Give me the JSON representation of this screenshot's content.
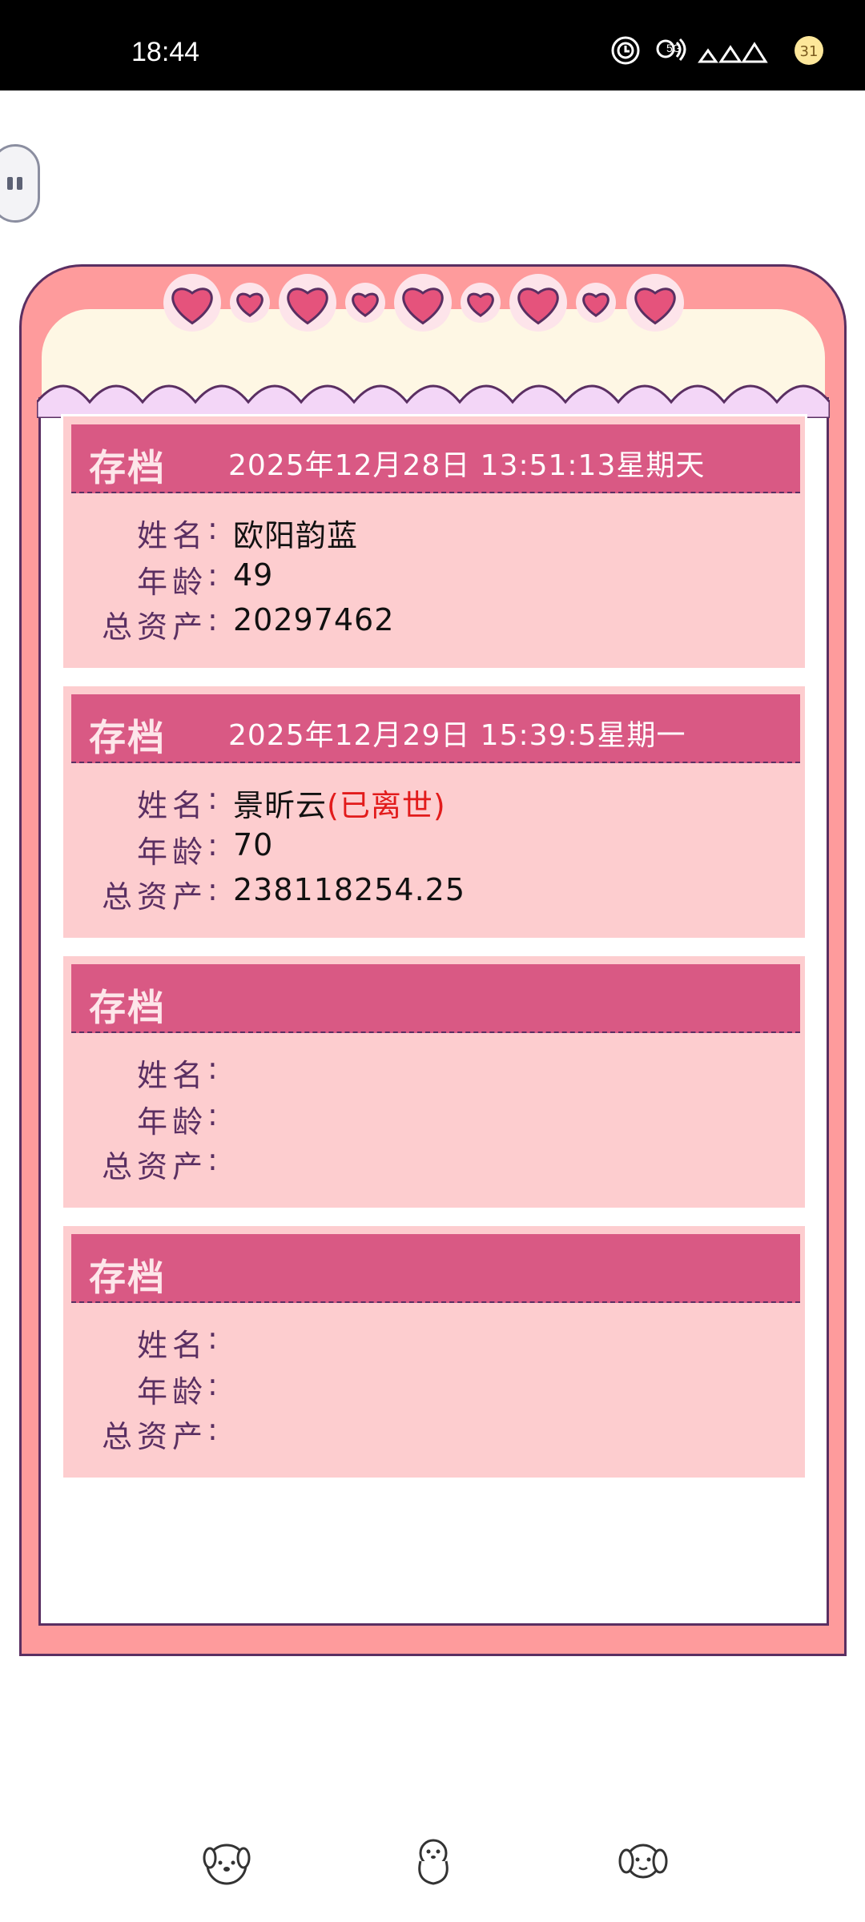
{
  "status_bar": {
    "time": "18:44",
    "network": "5G",
    "battery": "31"
  },
  "slots": [
    {
      "title": "存档",
      "date": "2025年12月28日 13:51:13星期天",
      "name_label": "姓名",
      "name": "欧阳韵蓝",
      "deceased": "",
      "age_label": "年龄",
      "age": "49",
      "assets_label": "总资产",
      "assets": "20297462"
    },
    {
      "title": "存档",
      "date": "2025年12月29日 15:39:5星期一",
      "name_label": "姓名",
      "name": "景昕云",
      "deceased": "(已离世)",
      "age_label": "年龄",
      "age": "70",
      "assets_label": "总资产",
      "assets": "238118254.25"
    },
    {
      "title": "存档",
      "date": "",
      "name_label": "姓名",
      "name": "",
      "deceased": "",
      "age_label": "年龄",
      "age": "",
      "assets_label": "总资产",
      "assets": ""
    },
    {
      "title": "存档",
      "date": "",
      "name_label": "姓名",
      "name": "",
      "deceased": "",
      "age_label": "年龄",
      "age": "",
      "assets_label": "总资产",
      "assets": ""
    }
  ],
  "nav": {
    "icons": [
      "puppy-face-icon",
      "puppy-sitting-icon",
      "puppy-head-icon"
    ]
  },
  "colors": {
    "frame": "#fe9b9c",
    "slot_bg": "#fdcdcf",
    "header": "#d95984",
    "outline": "#5a2f62",
    "deceased": "#e21b1b"
  }
}
